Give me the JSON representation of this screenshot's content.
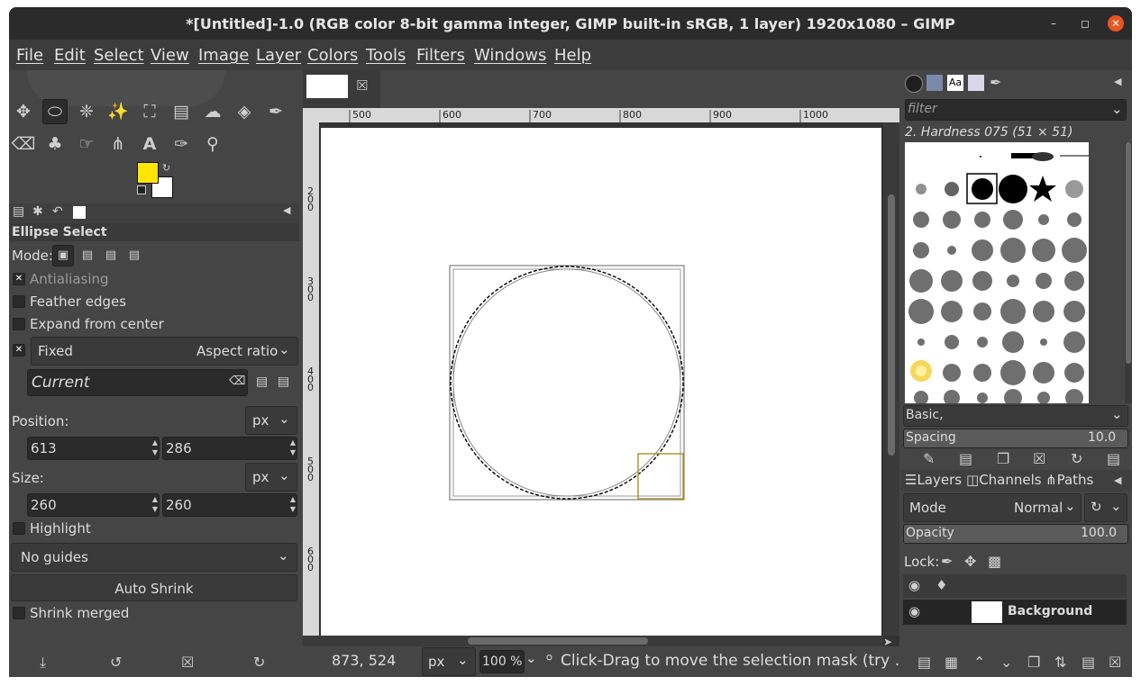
{
  "window": {
    "title": "*[Untitled]-1.0 (RGB color 8-bit gamma integer, GIMP built-in sRGB, 1 layer) 1920x1080 – GIMP"
  },
  "menubar": [
    "File",
    "Edit",
    "Select",
    "View",
    "Image",
    "Layer",
    "Colors",
    "Tools",
    "Filters",
    "Windows",
    "Help"
  ],
  "toolbox": {
    "fg_color": "#ffe600",
    "bg_color": "#ffffff"
  },
  "tool_options": {
    "tool_name": "Ellipse Select",
    "mode_label": "Mode:",
    "antialiasing": "Antialiasing",
    "feather": "Feather edges",
    "expand": "Expand from center",
    "fixed": "Fixed",
    "fixed_value": "Aspect ratio",
    "current": "Current",
    "position_label": "Position:",
    "position_unit": "px",
    "pos_x": "613",
    "pos_y": "286",
    "size_label": "Size:",
    "size_unit": "px",
    "size_w": "260",
    "size_h": "260",
    "highlight": "Highlight",
    "guides": "No guides",
    "auto_shrink": "Auto Shrink",
    "shrink_merged": "Shrink merged"
  },
  "rulers": {
    "h_ticks": [
      "500",
      "600",
      "700",
      "800",
      "900",
      "1000"
    ],
    "v_ticks": [
      "200",
      "300",
      "400",
      "500",
      "600"
    ]
  },
  "statusbar": {
    "coords": "873, 524",
    "unit": "px",
    "zoom": "100 %",
    "message": "Click-Drag to move the selection mask (try …"
  },
  "brushes": {
    "filter_placeholder": "filter",
    "selected": "2. Hardness 075 (51 × 51)",
    "preset": "Basic,",
    "spacing_label": "Spacing",
    "spacing_value": "10.0"
  },
  "layers": {
    "tabs": [
      "Layers",
      "Channels",
      "Paths"
    ],
    "mode_label": "Mode",
    "mode_value": "Normal",
    "opacity_label": "Opacity",
    "opacity_value": "100.0",
    "lock_label": "Lock:",
    "layer_name": "Background"
  }
}
